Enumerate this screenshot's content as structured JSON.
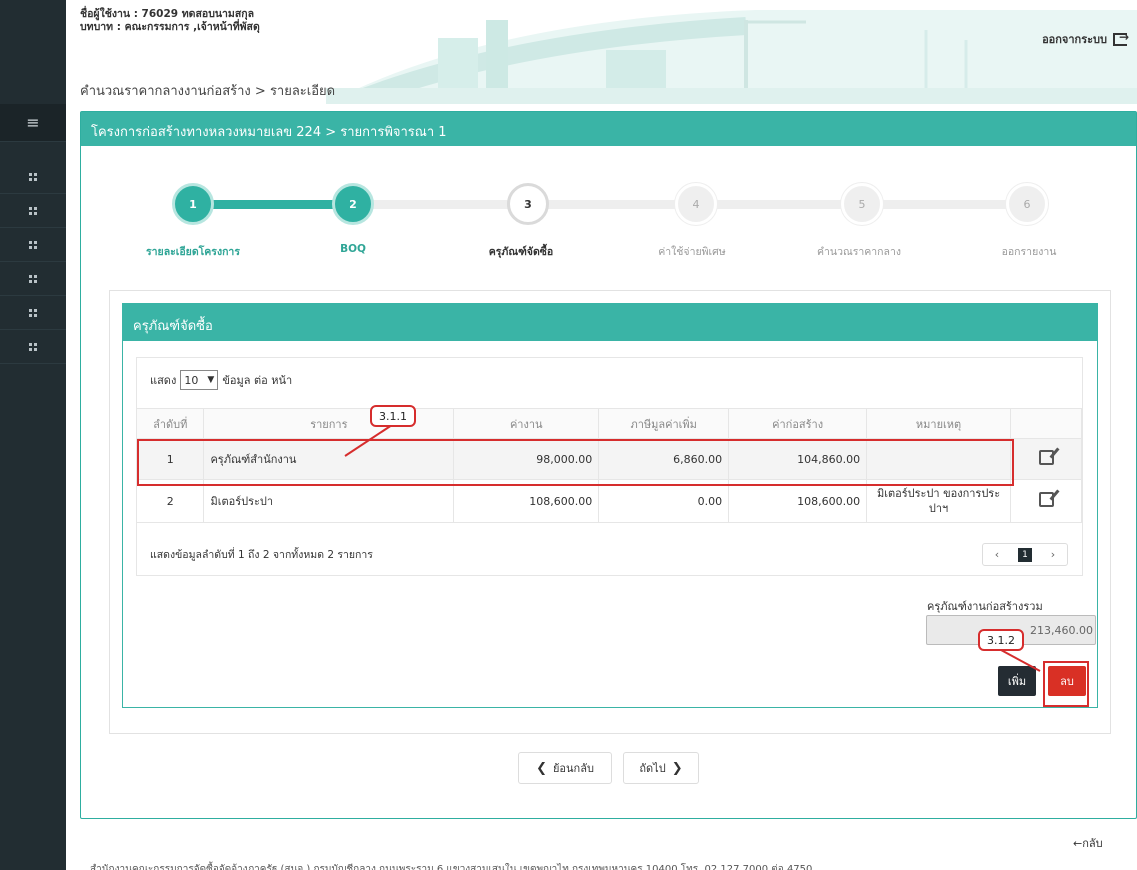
{
  "header": {
    "user_line": "ชื่อผู้ใช้งาน : 76029 ทดสอบนามสกุล",
    "role_line": "บทบาท : คณะกรรมการ ,เจ้าหน้าที่พัสดุ",
    "logout_label": "ออกจากระบบ",
    "page_title": "คำนวณราคากลางงานก่อสร้าง > รายละเอียด"
  },
  "panel": {
    "title": "โครงการก่อสร้างทางหลวงหมายเลข 224 > รายการพิจารณา 1"
  },
  "steps": [
    {
      "num": "1",
      "label": "รายละเอียดโครงการ",
      "state": "done"
    },
    {
      "num": "2",
      "label": "BOQ",
      "state": "done"
    },
    {
      "num": "3",
      "label": "ครุภัณฑ์จัดซื้อ",
      "state": "current"
    },
    {
      "num": "4",
      "label": "ค่าใช้จ่ายพิเศษ",
      "state": "todo"
    },
    {
      "num": "5",
      "label": "คำนวณราคากลาง",
      "state": "todo"
    },
    {
      "num": "6",
      "label": "ออกรายงาน",
      "state": "todo"
    }
  ],
  "card": {
    "title": "ครุภัณฑ์จัดซื้อ",
    "show_prefix": "แสดง",
    "show_value": "10",
    "show_suffix": "ข้อมูล ต่อ หน้า",
    "columns": [
      "ลำดับที่",
      "รายการ",
      "ค่างาน",
      "ภาษีมูลค่าเพิ่ม",
      "ค่าก่อสร้าง",
      "หมายเหตุ"
    ],
    "rows": [
      {
        "no": "1",
        "item": "ครุภัณฑ์สำนักงาน",
        "cost": "98,000.00",
        "vat": "6,860.00",
        "total": "104,860.00",
        "note": ""
      },
      {
        "no": "2",
        "item": "มิเตอร์ประปา",
        "cost": "108,600.00",
        "vat": "0.00",
        "total": "108,600.00",
        "note": "มิเตอร์ประปา ของการประปาฯ"
      }
    ],
    "footer_info": "แสดงข้อมูลลำดับที่ 1 ถึง 2 จากทั้งหมด 2 รายการ",
    "pager": {
      "prev": "‹",
      "current": "1",
      "next": "›"
    },
    "total_label": "ครุภัณฑ์งานก่อสร้างรวม",
    "total_value": "213,460.00",
    "add_label": "เพิ่ม",
    "delete_label": "ลบ"
  },
  "annotations": {
    "row_callout": "3.1.1",
    "delete_callout": "3.1.2"
  },
  "nav": {
    "back_label": "ย้อนกลับ",
    "next_label": "ถัดไป",
    "back_small": "←กลับ"
  },
  "footer": {
    "text": "สำนักงานคณะกรรมการจัดซื้อจัดจ้างภาครัฐ (สนจ.) กรมบัญชีกลาง ถนนพระราม 6 แขวงสามเสนใน เขตพญาไท กรุงเทพมหานคร 10400 โทร. 02 127 7000 ต่อ 4750"
  },
  "colors": {
    "accent": "#3ab4a6",
    "sidebar": "#222d32",
    "danger": "#d93025"
  }
}
